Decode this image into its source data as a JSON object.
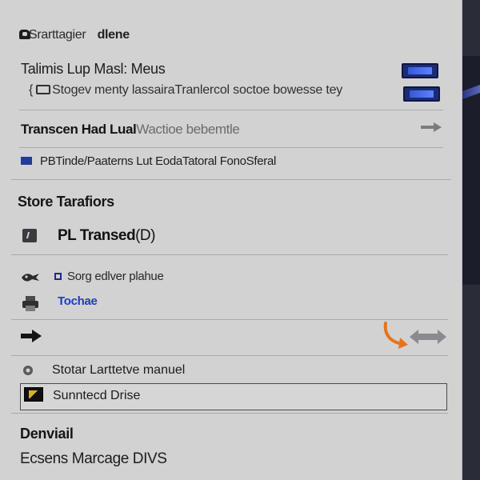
{
  "header": {
    "title": "Srarttagier",
    "subtitle": "dlene",
    "icon": "gear-icon"
  },
  "menu": {
    "title": "Talimis Lup Masl: Meus",
    "subtitle_bracket": "{",
    "subtitle": "Stogev menty lassairaTranlercol soctoe bowesse tey",
    "toggle_colors": [
      "#1b2c74",
      "#4a6cf0"
    ]
  },
  "transcen": {
    "dark_text": "Transcen Had Lual",
    "light_text": "Wactioe bebemtle"
  },
  "pbt": {
    "text": "PBTinde/Paaterns  Lut  EodaTatoral FonoSferal"
  },
  "store_section": {
    "heading": "Store Tarafiors",
    "item_label": "PL Transed",
    "item_suffix": "(D)",
    "item_icon": "edit-icon"
  },
  "list": {
    "item1": "Sorg edlver plahue",
    "item2": "Tochae"
  },
  "actions": {
    "arrow_icon": "arrow-right-icon",
    "swap_icon": "swap-arrows-icon",
    "accent_color": "#e8731c"
  },
  "options": {
    "stotar_label": "Stotar Larttetve manuel",
    "sunt_label": "Sunntecd Drise"
  },
  "footer": {
    "heading": "Denviail",
    "text": "Ecsens Marcage DIVS"
  }
}
